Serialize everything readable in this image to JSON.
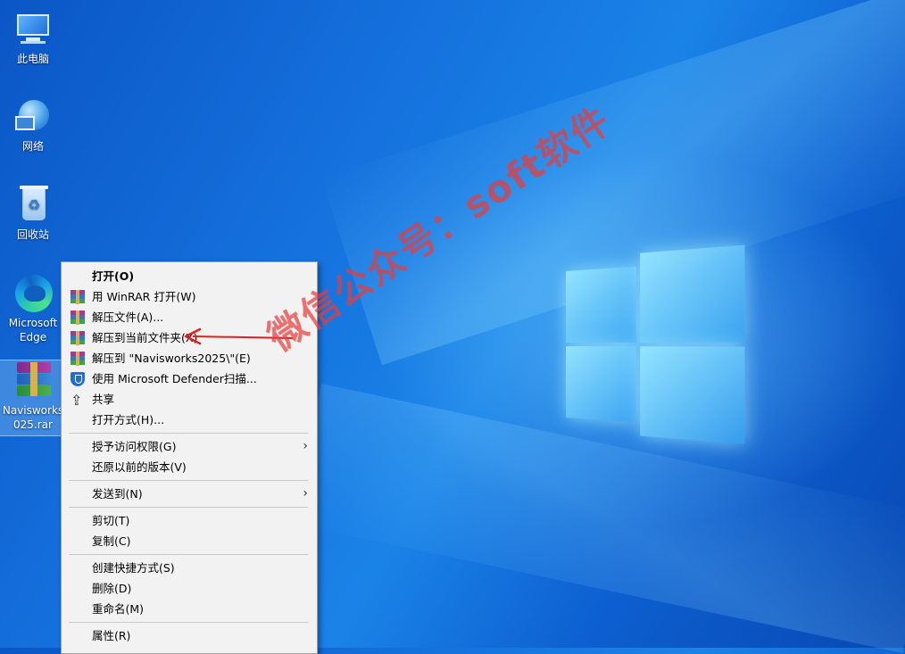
{
  "desktop": {
    "icons": [
      {
        "label": "此电脑",
        "icon": "this-pc-icon"
      },
      {
        "label": "网络",
        "icon": "network-icon"
      },
      {
        "label": "回收站",
        "icon": "recycle-bin-icon"
      },
      {
        "label_line1": "Microsoft",
        "label_line2": "Edge",
        "icon": "edge-icon"
      },
      {
        "label_line1": "Navisworks",
        "label_line2": "025.rar",
        "icon": "winrar-archive-icon",
        "selected": true
      }
    ]
  },
  "context_menu": {
    "items": [
      {
        "label": "打开(O)",
        "bold": true
      },
      {
        "label": "用 WinRAR 打开(W)",
        "icon": "winrar-icon"
      },
      {
        "label": "解压文件(A)...",
        "icon": "winrar-icon"
      },
      {
        "label": "解压到当前文件夹(X)",
        "icon": "winrar-icon"
      },
      {
        "label": "解压到 \"Navisworks2025\\\"(E)",
        "icon": "winrar-icon"
      },
      {
        "label": "使用 Microsoft Defender扫描...",
        "icon": "defender-shield-icon"
      },
      {
        "label": "共享",
        "icon": "share-icon"
      },
      {
        "label": "打开方式(H)..."
      },
      {
        "label": "授予访问权限(G)",
        "submenu": true
      },
      {
        "label": "还原以前的版本(V)"
      },
      {
        "label": "发送到(N)",
        "submenu": true
      },
      {
        "label": "剪切(T)"
      },
      {
        "label": "复制(C)"
      },
      {
        "label": "创建快捷方式(S)"
      },
      {
        "label": "删除(D)"
      },
      {
        "label": "重命名(M)"
      },
      {
        "label": "属性(R)"
      }
    ]
  },
  "watermark": "微信公众号：soft软件",
  "colors": {
    "annotation_arrow": "#e02020",
    "watermark": "#e63c3c"
  }
}
